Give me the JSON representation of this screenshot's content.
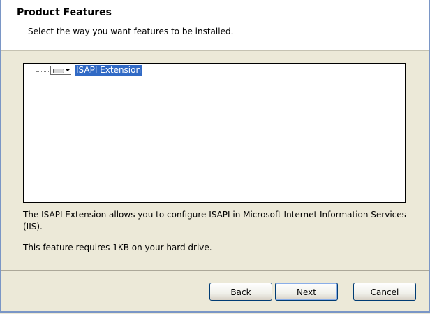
{
  "header": {
    "title": "Product Features",
    "subtitle": "Select the way you want features to be installed."
  },
  "tree": {
    "items": [
      {
        "label": "ISAPI Extension",
        "selected": true,
        "state_icon": "hard-drive-dropdown-icon"
      }
    ]
  },
  "details": {
    "description": "The ISAPI Extension allows you to configure ISAPI in Microsoft Internet Information Services (IIS).",
    "requirement": "This feature requires 1KB on your hard drive."
  },
  "buttons": {
    "back": "Back",
    "next": "Next",
    "cancel": "Cancel"
  },
  "colors": {
    "selection": "#316ac5",
    "dialog_bg": "#ece9d8",
    "border": "#7a96c6"
  }
}
